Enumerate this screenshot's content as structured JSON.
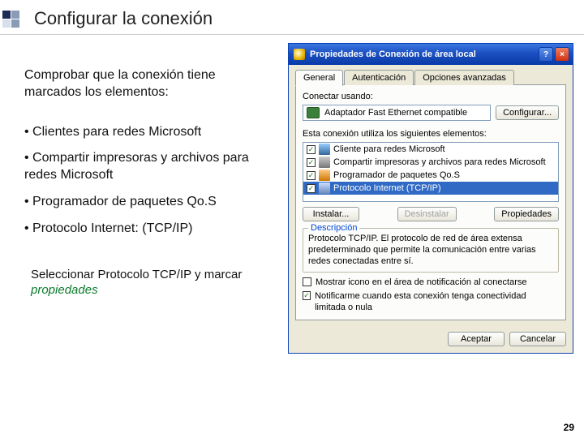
{
  "slide": {
    "title": "Configurar la conexión",
    "page_number": "29"
  },
  "left": {
    "intro": "Comprobar que la conexión tiene marcados los elementos:",
    "b1": "• Clientes para redes Microsoft",
    "b2": "• Compartir impresoras y archivos para redes Microsoft",
    "b3": "• Programador de paquetes Qo.S",
    "b4": "• Protocolo Internet: (TCP/IP)",
    "note_pre": "Seleccionar Protocolo TCP/IP y marcar ",
    "note_em": "propiedades"
  },
  "win": {
    "title": "Propiedades de Conexión de área local",
    "tabs": {
      "general": "General",
      "auth": "Autenticación",
      "adv": "Opciones avanzadas"
    },
    "connect_using": "Conectar usando:",
    "adapter": "Adaptador Fast Ethernet compatible",
    "btn_config": "Configurar...",
    "elements_label": "Esta conexión utiliza los siguientes elementos:",
    "items": {
      "cli": "Cliente para redes Microsoft",
      "share": "Compartir impresoras y archivos para redes Microsoft",
      "qos": "Programador de paquetes Qo.S",
      "tcp": "Protocolo Internet (TCP/IP)"
    },
    "btn_install": "Instalar...",
    "btn_uninstall": "Desinstalar",
    "btn_props": "Propiedades",
    "desc_legend": "Descripción",
    "desc_text": "Protocolo TCP/IP. El protocolo de red de área extensa predeterminado que permite la comunicación entre varias redes conectadas entre sí.",
    "chk_tray": "Mostrar icono en el área de notificación al conectarse",
    "chk_notify": "Notificarme cuando esta conexión tenga conectividad limitada o nula",
    "btn_ok": "Aceptar",
    "btn_cancel": "Cancelar"
  }
}
